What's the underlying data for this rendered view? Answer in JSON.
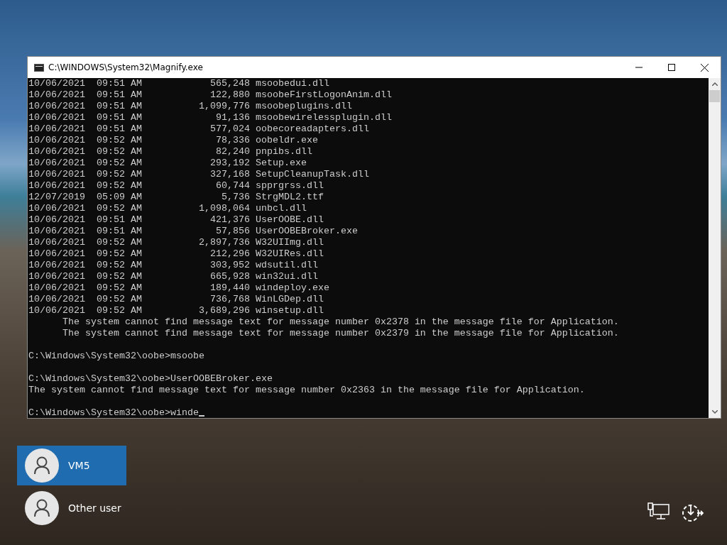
{
  "window": {
    "title": "C:\\WINDOWS\\System32\\Magnify.exe"
  },
  "console": {
    "listing": [
      {
        "date": "10/06/2021",
        "time": "09:51 AM",
        "size": "565,248",
        "name": "msoobedui.dll"
      },
      {
        "date": "10/06/2021",
        "time": "09:51 AM",
        "size": "122,880",
        "name": "msoobeFirstLogonAnim.dll"
      },
      {
        "date": "10/06/2021",
        "time": "09:51 AM",
        "size": "1,099,776",
        "name": "msoobeplugins.dll"
      },
      {
        "date": "10/06/2021",
        "time": "09:51 AM",
        "size": "91,136",
        "name": "msoobewirelessplugin.dll"
      },
      {
        "date": "10/06/2021",
        "time": "09:51 AM",
        "size": "577,024",
        "name": "oobecoreadapters.dll"
      },
      {
        "date": "10/06/2021",
        "time": "09:52 AM",
        "size": "78,336",
        "name": "oobeldr.exe"
      },
      {
        "date": "10/06/2021",
        "time": "09:52 AM",
        "size": "82,240",
        "name": "pnpibs.dll"
      },
      {
        "date": "10/06/2021",
        "time": "09:52 AM",
        "size": "293,192",
        "name": "Setup.exe"
      },
      {
        "date": "10/06/2021",
        "time": "09:52 AM",
        "size": "327,168",
        "name": "SetupCleanupTask.dll"
      },
      {
        "date": "10/06/2021",
        "time": "09:52 AM",
        "size": "60,744",
        "name": "spprgrss.dll"
      },
      {
        "date": "12/07/2019",
        "time": "05:09 AM",
        "size": "5,736",
        "name": "StrgMDL2.ttf"
      },
      {
        "date": "10/06/2021",
        "time": "09:52 AM",
        "size": "1,098,064",
        "name": "unbcl.dll"
      },
      {
        "date": "10/06/2021",
        "time": "09:51 AM",
        "size": "421,376",
        "name": "UserOOBE.dll"
      },
      {
        "date": "10/06/2021",
        "time": "09:51 AM",
        "size": "57,856",
        "name": "UserOOBEBroker.exe"
      },
      {
        "date": "10/06/2021",
        "time": "09:52 AM",
        "size": "2,897,736",
        "name": "W32UIImg.dll"
      },
      {
        "date": "10/06/2021",
        "time": "09:52 AM",
        "size": "212,296",
        "name": "W32UIRes.dll"
      },
      {
        "date": "10/06/2021",
        "time": "09:52 AM",
        "size": "303,952",
        "name": "wdsutil.dll"
      },
      {
        "date": "10/06/2021",
        "time": "09:52 AM",
        "size": "665,928",
        "name": "win32ui.dll"
      },
      {
        "date": "10/06/2021",
        "time": "09:52 AM",
        "size": "189,440",
        "name": "windeploy.exe"
      },
      {
        "date": "10/06/2021",
        "time": "09:52 AM",
        "size": "736,768",
        "name": "WinLGDep.dll"
      },
      {
        "date": "10/06/2021",
        "time": "09:52 AM",
        "size": "3,689,296",
        "name": "winsetup.dll"
      }
    ],
    "lines": [
      {
        "kind": "indented",
        "text": "The system cannot find message text for message number 0x2378 in the message file for Application."
      },
      {
        "kind": "indented",
        "text": "The system cannot find message text for message number 0x2379 in the message file for Application."
      },
      {
        "kind": "blank"
      },
      {
        "kind": "text",
        "text": "C:\\Windows\\System32\\oobe>msoobe"
      },
      {
        "kind": "blank"
      },
      {
        "kind": "text",
        "text": "C:\\Windows\\System32\\oobe>UserOOBEBroker.exe"
      },
      {
        "kind": "text",
        "text": "The system cannot find message text for message number 0x2363 in the message file for Application."
      },
      {
        "kind": "blank"
      },
      {
        "kind": "prompt",
        "text": "C:\\Windows\\System32\\oobe>winde"
      }
    ]
  },
  "users": [
    {
      "name": "VM5",
      "selected": true
    },
    {
      "name": "Other user",
      "selected": false
    }
  ]
}
